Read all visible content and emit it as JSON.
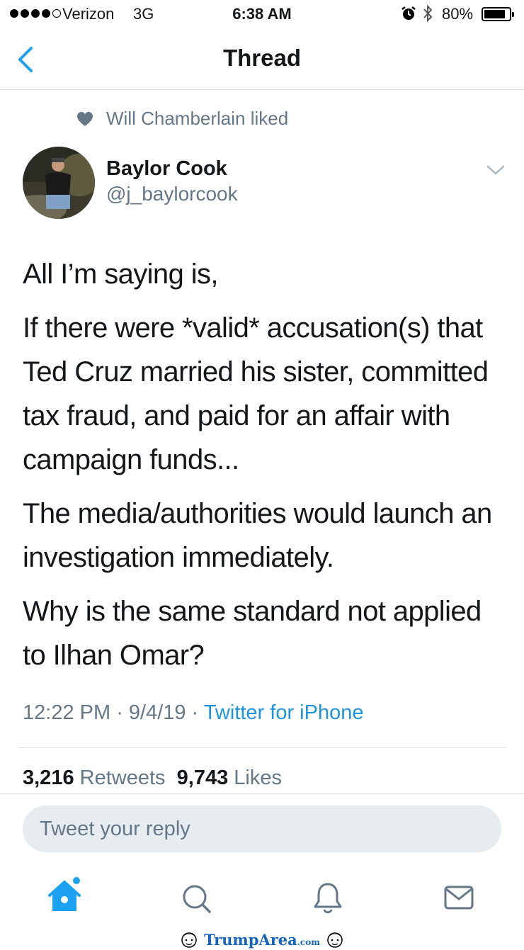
{
  "status_bar": {
    "carrier": "Verizon",
    "network": "3G",
    "time": "6:38 AM",
    "battery": "80%",
    "battery_level": 0.8,
    "signal_bars": 4
  },
  "nav": {
    "title": "Thread"
  },
  "social_context": {
    "text": "Will Chamberlain liked",
    "icon": "heart-icon"
  },
  "tweet": {
    "name": "Baylor Cook",
    "handle": "@j_baylorcook",
    "paragraphs": [
      "All I’m saying is,",
      "If there were *valid* accusation(s) that Ted Cruz married his sister, committed tax fraud, and paid for an affair with campaign funds...",
      "The media/authorities would launch an investigation immediately.",
      "Why is the same standard not applied to Ilhan Omar?"
    ],
    "time": "12:22 PM",
    "date": "9/4/19",
    "source": "Twitter for iPhone",
    "separator": " · "
  },
  "stats": {
    "retweets_count": "3,216",
    "retweets_label": "Retweets",
    "likes_count": "9,743",
    "likes_label": "Likes"
  },
  "reply": {
    "placeholder": "Tweet your reply"
  },
  "tabs": [
    "home-icon",
    "search-icon",
    "bell-icon",
    "mail-icon"
  ],
  "colors": {
    "accent": "#1da1f2",
    "link": "#1b95e0",
    "muted": "#657786",
    "text": "#14171a"
  },
  "watermark": {
    "brand": "TrumpArea",
    "suffix": ".com"
  }
}
